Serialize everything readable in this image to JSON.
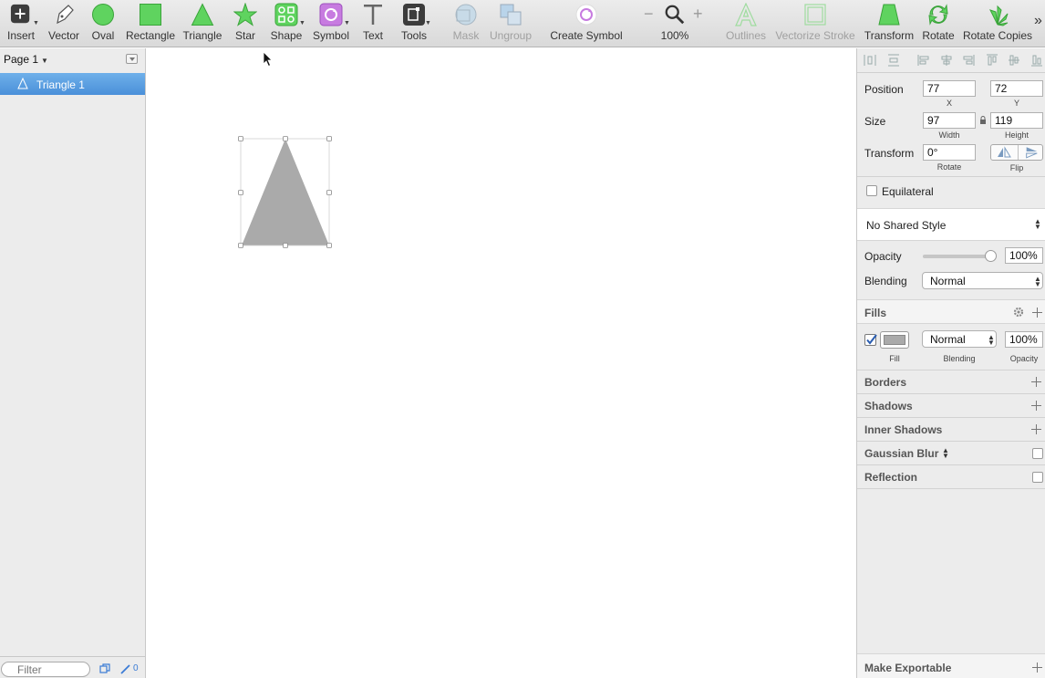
{
  "toolbar": {
    "insert": "Insert",
    "vector": "Vector",
    "oval": "Oval",
    "rectangle": "Rectangle",
    "triangle": "Triangle",
    "star": "Star",
    "shape": "Shape",
    "symbol": "Symbol",
    "text": "Text",
    "tools": "Tools",
    "mask": "Mask",
    "ungroup": "Ungroup",
    "create_symbol": "Create Symbol",
    "zoom": "100%",
    "outlines": "Outlines",
    "vectorize_stroke": "Vectorize Stroke",
    "transform": "Transform",
    "rotate": "Rotate",
    "rotate_copies": "Rotate Copies",
    "more": "»"
  },
  "colors": {
    "accent": "#4a90d9",
    "shape_fill": "#aaaaaa",
    "green_tool": "#5fd35f",
    "symbol_purple": "#c77be0"
  },
  "left_panel": {
    "page": "Page 1",
    "layers": [
      {
        "name": "Triangle 1",
        "icon": "triangle-icon",
        "selected": true
      }
    ],
    "filter_placeholder": "Filter",
    "slice_count": "0"
  },
  "inspector": {
    "position_label": "Position",
    "x_value": "77",
    "y_value": "72",
    "x_label": "X",
    "y_label": "Y",
    "size_label": "Size",
    "width_value": "97",
    "height_value": "119",
    "width_label": "Width",
    "height_label": "Height",
    "transform_label": "Transform",
    "rotate_value": "0°",
    "rotate_label": "Rotate",
    "flip_label": "Flip",
    "equilateral_label": "Equilateral",
    "shared_style": "No Shared Style",
    "opacity_label": "Opacity",
    "opacity_value": "100%",
    "opacity_level": 1.0,
    "blending_label": "Blending",
    "blending_value": "Normal",
    "fills_title": "Fills",
    "fill_blending": "Normal",
    "fill_opacity": "100%",
    "fill_label": "Fill",
    "fill_blending_label": "Blending",
    "fill_opacity_label": "Opacity",
    "borders": "Borders",
    "shadows": "Shadows",
    "inner_shadows": "Inner Shadows",
    "gaussian_blur": "Gaussian Blur",
    "reflection": "Reflection",
    "make_exportable": "Make Exportable"
  }
}
